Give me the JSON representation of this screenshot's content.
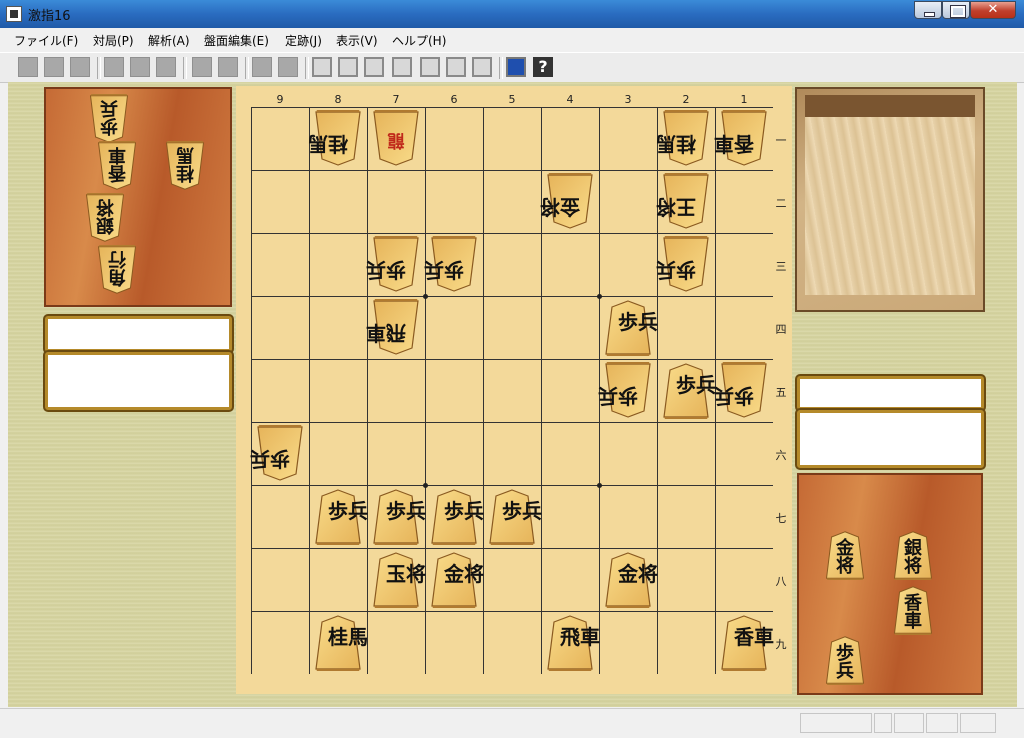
{
  "window": {
    "title": "激指16",
    "icon": "app-shogi-icon"
  },
  "menu": [
    "ファイル(F)",
    "対局(P)",
    "解析(A)",
    "盤面編集(E)",
    "定跡(J)",
    "表示(V)",
    "ヘルプ(H)"
  ],
  "toolbar": {
    "icons": [
      "new-game-icon",
      "open-icon",
      "save-icon",
      "move-back-to-start-icon",
      "undo-icon",
      "redo-icon",
      "analysis-icon",
      "hint-icon",
      "edit-board-icon",
      "edit-mode-icon",
      "first-move-icon",
      "prev-move-icon",
      "prev-branch-icon",
      "stop-icon",
      "next-branch-icon",
      "next-move-icon",
      "last-move-icon",
      "computer-icon",
      "help-icon"
    ]
  },
  "board": {
    "files": [
      "9",
      "8",
      "7",
      "6",
      "5",
      "4",
      "3",
      "2",
      "1"
    ],
    "ranks": [
      "一",
      "二",
      "三",
      "四",
      "五",
      "六",
      "七",
      "八",
      "九"
    ],
    "pieces": [
      {
        "file": 8,
        "rank": 1,
        "label": "桂馬",
        "owner": "gote",
        "name": "piece-gote-keima-8-1"
      },
      {
        "file": 7,
        "rank": 1,
        "label": "龍",
        "owner": "gote",
        "promoted": true,
        "name": "piece-gote-ryu-7-1"
      },
      {
        "file": 2,
        "rank": 1,
        "label": "桂馬",
        "owner": "gote",
        "name": "piece-gote-keima-2-1"
      },
      {
        "file": 1,
        "rank": 1,
        "label": "香車",
        "owner": "gote",
        "name": "piece-gote-kyosha-1-1"
      },
      {
        "file": 4,
        "rank": 2,
        "label": "金将",
        "owner": "gote",
        "name": "piece-gote-kin-4-2"
      },
      {
        "file": 2,
        "rank": 2,
        "label": "王将",
        "owner": "gote",
        "name": "piece-gote-ou-2-2"
      },
      {
        "file": 7,
        "rank": 3,
        "label": "歩兵",
        "owner": "gote",
        "name": "piece-gote-fu-7-3"
      },
      {
        "file": 6,
        "rank": 3,
        "label": "歩兵",
        "owner": "gote",
        "name": "piece-gote-fu-6-3"
      },
      {
        "file": 2,
        "rank": 3,
        "label": "歩兵",
        "owner": "gote",
        "name": "piece-gote-fu-2-3"
      },
      {
        "file": 7,
        "rank": 4,
        "label": "飛車",
        "owner": "gote",
        "name": "piece-gote-hisha-7-4"
      },
      {
        "file": 3,
        "rank": 4,
        "label": "歩兵",
        "owner": "sente",
        "name": "piece-sente-fu-3-4"
      },
      {
        "file": 3,
        "rank": 5,
        "label": "歩兵",
        "owner": "gote",
        "name": "piece-gote-fu-3-5"
      },
      {
        "file": 2,
        "rank": 5,
        "label": "歩兵",
        "owner": "sente",
        "name": "piece-sente-fu-2-5"
      },
      {
        "file": 1,
        "rank": 5,
        "label": "歩兵",
        "owner": "gote",
        "name": "piece-gote-fu-1-5"
      },
      {
        "file": 9,
        "rank": 6,
        "label": "歩兵",
        "owner": "gote",
        "name": "piece-gote-fu-9-6"
      },
      {
        "file": 8,
        "rank": 7,
        "label": "歩兵",
        "owner": "sente",
        "name": "piece-sente-fu-8-7"
      },
      {
        "file": 7,
        "rank": 7,
        "label": "歩兵",
        "owner": "sente",
        "name": "piece-sente-fu-7-7"
      },
      {
        "file": 6,
        "rank": 7,
        "label": "歩兵",
        "owner": "sente",
        "name": "piece-sente-fu-6-7"
      },
      {
        "file": 5,
        "rank": 7,
        "label": "歩兵",
        "owner": "sente",
        "name": "piece-sente-fu-5-7"
      },
      {
        "file": 7,
        "rank": 8,
        "label": "玉将",
        "owner": "sente",
        "name": "piece-sente-gyoku-7-8"
      },
      {
        "file": 6,
        "rank": 8,
        "label": "金将",
        "owner": "sente",
        "name": "piece-sente-kin-6-8"
      },
      {
        "file": 3,
        "rank": 8,
        "label": "金将",
        "owner": "sente",
        "name": "piece-sente-kin-3-8"
      },
      {
        "file": 8,
        "rank": 9,
        "label": "桂馬",
        "owner": "sente",
        "name": "piece-sente-keima-8-9"
      },
      {
        "file": 4,
        "rank": 9,
        "label": "飛車",
        "owner": "sente",
        "name": "piece-sente-hisha-4-9"
      },
      {
        "file": 1,
        "rank": 9,
        "label": "香車",
        "owner": "sente",
        "name": "piece-sente-kyosha-1-9"
      }
    ]
  },
  "gote_hand": [
    {
      "label": "歩兵",
      "name": "gote-hand-fu"
    },
    {
      "label": "香車",
      "name": "gote-hand-kyosha"
    },
    {
      "label": "桂馬",
      "name": "gote-hand-keima"
    },
    {
      "label": "銀将",
      "name": "gote-hand-gin"
    },
    {
      "label": "角行",
      "name": "gote-hand-kaku"
    }
  ],
  "sente_hand": [
    {
      "label": "金将",
      "name": "sente-hand-kin"
    },
    {
      "label": "銀将",
      "name": "sente-hand-gin"
    },
    {
      "label": "香車",
      "name": "sente-hand-kyosha"
    },
    {
      "label": "歩兵",
      "name": "sente-hand-fu"
    }
  ],
  "players": {
    "gote_name": "",
    "gote_time": "",
    "sente_name": "",
    "sente_time": ""
  }
}
